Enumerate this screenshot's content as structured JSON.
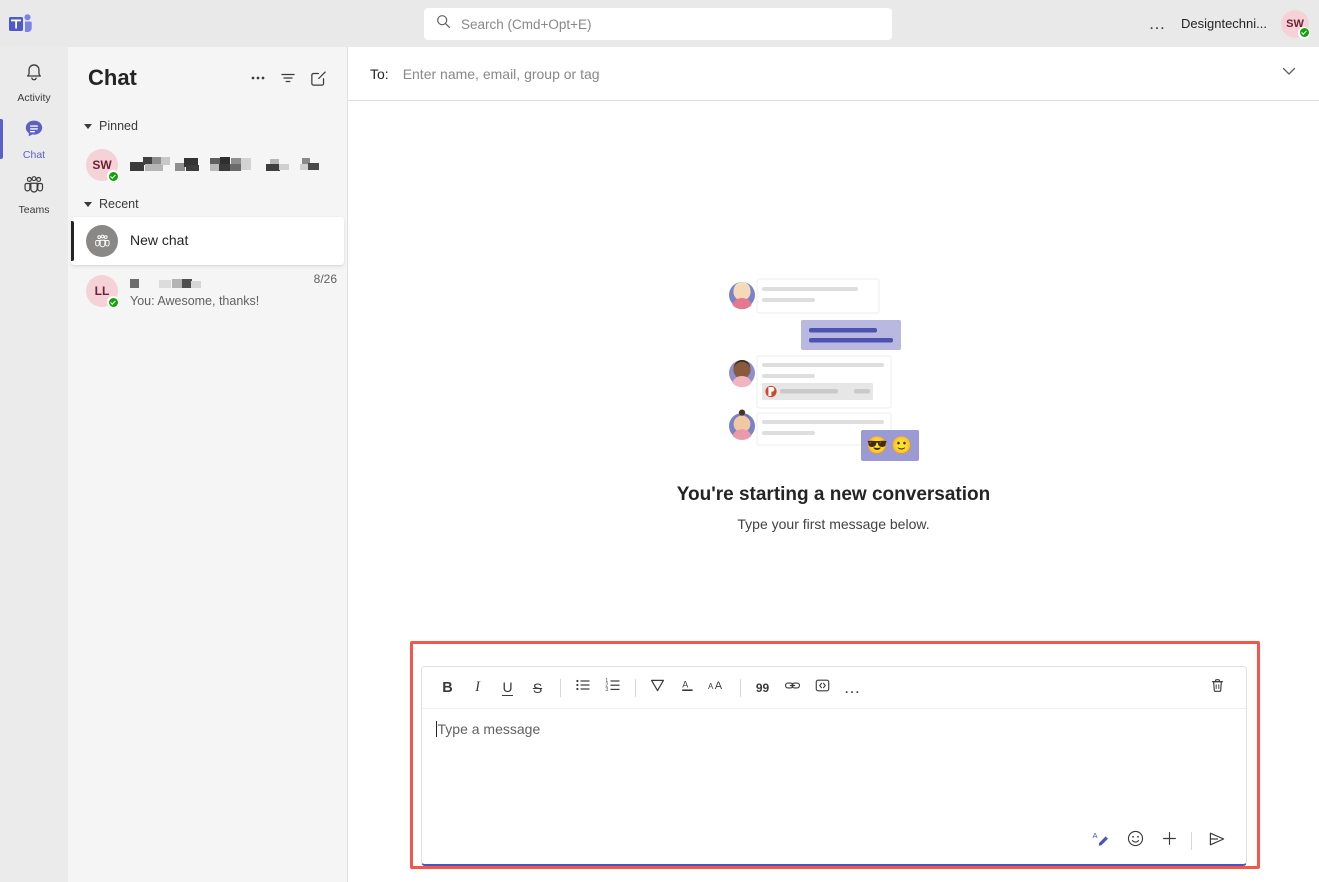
{
  "titlebar": {
    "logo_icon": "teams-logo-icon",
    "search": {
      "icon": "search-icon",
      "placeholder": "Search (Cmd+Opt+E)",
      "value": ""
    },
    "more_label": "…",
    "user_name": "Designtechni...",
    "avatar_initials": "SW",
    "avatar_bg": "#f4d2d8",
    "presence_color": "#13a10e"
  },
  "rail": {
    "items": [
      {
        "label": "Activity",
        "icon": "bell-icon",
        "active": false
      },
      {
        "label": "Chat",
        "icon": "chat-icon",
        "active": true
      },
      {
        "label": "Teams",
        "icon": "teams-people-icon",
        "active": false
      }
    ]
  },
  "chat_pane": {
    "title": "Chat",
    "header_buttons": [
      {
        "name": "more-options-button",
        "icon": "ellipsis-icon"
      },
      {
        "name": "filter-button",
        "icon": "filter-icon"
      },
      {
        "name": "new-chat-button",
        "icon": "compose-icon"
      }
    ],
    "groups": [
      {
        "label": "Pinned",
        "rows": [
          {
            "avatar_initials": "SW",
            "avatar_bg": "#f4d2d8",
            "title": "",
            "title_redacted": true,
            "subtitle": "",
            "date": "",
            "presence": true,
            "selected": false
          }
        ]
      },
      {
        "label": "Recent",
        "rows": [
          {
            "avatar_initials": "",
            "avatar_bg": "#8a8886",
            "avatar_icon": "group-avatar-icon",
            "title": "New chat",
            "title_redacted": false,
            "subtitle": "",
            "date": "",
            "presence": false,
            "selected": true
          },
          {
            "avatar_initials": "LL",
            "avatar_bg": "#f4d2d8",
            "title": "",
            "title_redacted": true,
            "subtitle": "You: Awesome, thanks!",
            "date": "8/26",
            "presence": true,
            "selected": false
          }
        ]
      }
    ]
  },
  "conversation": {
    "to_label": "To:",
    "to_placeholder": "Enter name, email, group or tag",
    "to_value": "",
    "expand_icon": "chevron-down-icon",
    "empty_state": {
      "illustration": "new-conversation-illustration",
      "heading": "You're starting a new conversation",
      "subtext": "Type your first message below.",
      "emoji_one": "😎",
      "emoji_two": "🙂",
      "bubble_accent": "#9a9ad4"
    }
  },
  "compose": {
    "highlight_color": "#f3574b",
    "focus_border": "#4b53bc",
    "message_placeholder": "Type a message",
    "message_value": "",
    "format_buttons": [
      {
        "name": "bold-button",
        "icon": "bold-icon",
        "label": "B"
      },
      {
        "name": "italic-button",
        "icon": "italic-icon",
        "label": "I"
      },
      {
        "name": "underline-button",
        "icon": "underline-icon",
        "label": "U"
      },
      {
        "name": "strikethrough-button",
        "icon": "strikethrough-icon",
        "label": "S"
      },
      {
        "name": "bulleted-list-button",
        "icon": "bulleted-list-icon",
        "label": ""
      },
      {
        "name": "numbered-list-button",
        "icon": "numbered-list-icon",
        "label": ""
      },
      {
        "name": "highlight-button",
        "icon": "highlight-icon",
        "label": ""
      },
      {
        "name": "font-color-button",
        "icon": "font-color-icon",
        "label": "A"
      },
      {
        "name": "font-size-button",
        "icon": "font-size-icon",
        "label": ""
      },
      {
        "name": "quote-button",
        "icon": "quote-icon",
        "label": "99"
      },
      {
        "name": "insert-link-button",
        "icon": "link-icon",
        "label": ""
      },
      {
        "name": "code-block-button",
        "icon": "code-icon",
        "label": ""
      },
      {
        "name": "more-formatting-button",
        "icon": "ellipsis-icon",
        "label": "…"
      }
    ],
    "delete_button": {
      "name": "discard-draft-button",
      "icon": "trash-icon"
    },
    "action_buttons": [
      {
        "name": "format-toggle-button",
        "icon": "format-pen-icon",
        "active": true
      },
      {
        "name": "emoji-button",
        "icon": "emoji-icon",
        "active": false
      },
      {
        "name": "more-actions-button",
        "icon": "plus-icon",
        "active": false
      },
      {
        "name": "send-button",
        "icon": "send-icon",
        "active": false
      }
    ]
  }
}
